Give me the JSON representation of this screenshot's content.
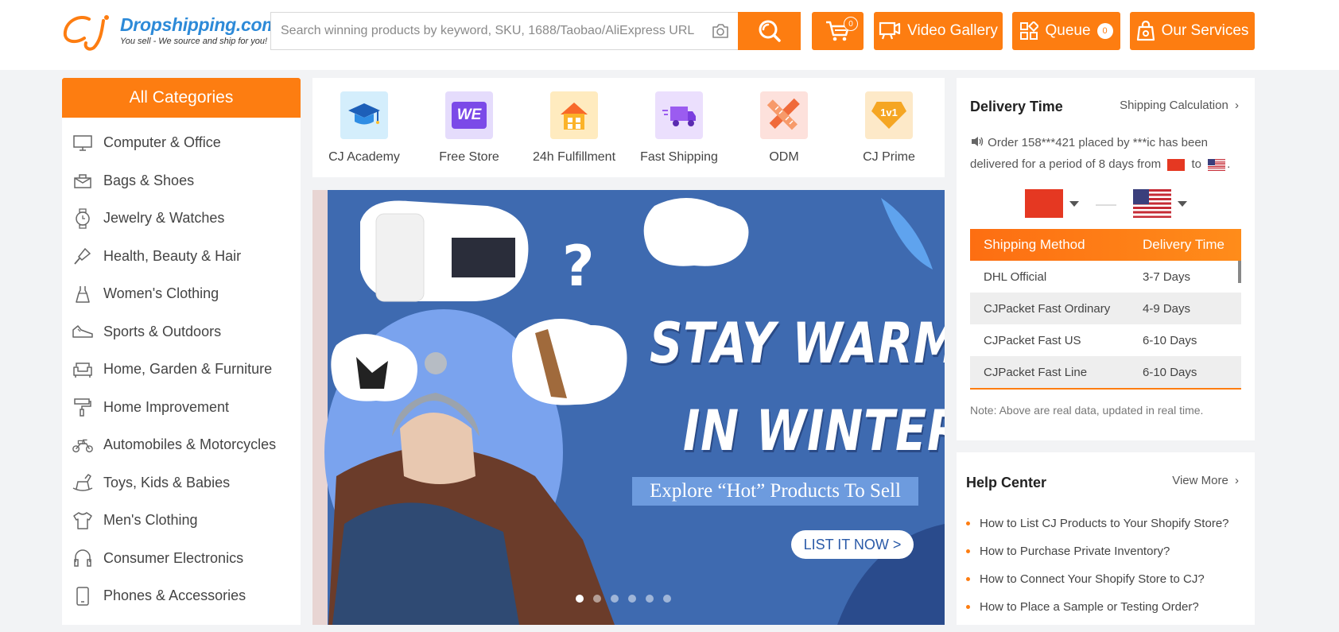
{
  "colors": {
    "accent": "#fd7d11",
    "brand_blue": "#2d8ad8",
    "banner_bg": "#3e6ab0"
  },
  "header": {
    "logo_name": "Dropshipping.com",
    "logo_tagline": "You sell - We source and ship for you!",
    "search_placeholder": "Search winning products by keyword, SKU, 1688/Taobao/AliExpress URL",
    "cart_count": "0",
    "video_gallery": "Video Gallery",
    "queue": "Queue",
    "queue_count": "0",
    "our_services": "Our Services"
  },
  "categories": {
    "title": "All Categories",
    "items": [
      {
        "label": "Computer & Office",
        "icon": "computer-icon"
      },
      {
        "label": "Bags & Shoes",
        "icon": "bag-icon"
      },
      {
        "label": "Jewelry & Watches",
        "icon": "watch-icon"
      },
      {
        "label": "Health, Beauty & Hair",
        "icon": "brush-icon"
      },
      {
        "label": "Women's Clothing",
        "icon": "dress-icon"
      },
      {
        "label": "Sports & Outdoors",
        "icon": "sneaker-icon"
      },
      {
        "label": "Home, Garden & Furniture",
        "icon": "sofa-icon"
      },
      {
        "label": "Home Improvement",
        "icon": "paint-roller-icon"
      },
      {
        "label": "Automobiles & Motorcycles",
        "icon": "motorcycle-icon"
      },
      {
        "label": "Toys, Kids & Babies",
        "icon": "rocking-horse-icon"
      },
      {
        "label": "Men's Clothing",
        "icon": "shirt-icon"
      },
      {
        "label": "Consumer Electronics",
        "icon": "headphones-icon"
      },
      {
        "label": "Phones & Accessories",
        "icon": "phone-icon"
      }
    ]
  },
  "quick_links": [
    {
      "label": "CJ Academy",
      "icon": "graduation-cap-icon"
    },
    {
      "label": "Free Store",
      "icon": "we-store-icon",
      "icon_text": "WE"
    },
    {
      "label": "24h Fulfillment",
      "icon": "house-icon"
    },
    {
      "label": "Fast Shipping",
      "icon": "truck-icon"
    },
    {
      "label": "ODM",
      "icon": "ruler-pencil-icon"
    },
    {
      "label": "CJ Prime",
      "icon": "prime-diamond-icon",
      "icon_text": "1v1"
    }
  ],
  "banner": {
    "title_line1": "STAY WARM",
    "title_line2": "IN WINTER",
    "subtitle": "Explore “Hot” Products To Sell",
    "cta": "LIST IT NOW >",
    "slide_count": 6,
    "active_slide": 1
  },
  "delivery": {
    "title": "Delivery Time",
    "link": "Shipping Calculation",
    "notice_text": "Order 158***421 placed by ***ic has been delivered for a period of 8 days from",
    "notice_to": "to",
    "from_country": "China",
    "to_country": "United States",
    "table": {
      "headers": [
        "Shipping Method",
        "Delivery Time"
      ],
      "rows": [
        [
          "DHL Official",
          "3-7 Days"
        ],
        [
          "CJPacket Fast Ordinary",
          "4-9 Days"
        ],
        [
          "CJPacket Fast US",
          "6-10 Days"
        ],
        [
          "CJPacket Fast Line",
          "6-10 Days"
        ]
      ]
    },
    "note": "Note: Above are real data, updated in real time."
  },
  "help": {
    "title": "Help Center",
    "link": "View More",
    "items": [
      "How to List CJ Products to Your Shopify Store?",
      "How to Purchase Private Inventory?",
      "How to Connect Your Shopify Store to CJ?",
      "How to Place a Sample or Testing Order?"
    ]
  }
}
